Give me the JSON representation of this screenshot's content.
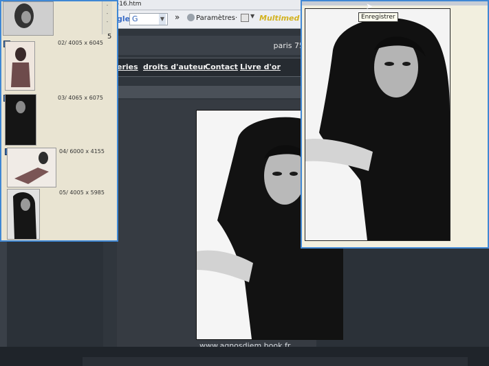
{
  "browser": {
    "url_fragment": "-16.htm",
    "google_logo": "gle",
    "google_combo": "G",
    "more": "»",
    "settings_label": "Paramètres",
    "toolbar_brand": "Multimed"
  },
  "site": {
    "city": "paris 75",
    "nav": [
      "eries",
      "droits d'auteur",
      "Contact",
      "Livre d'or"
    ],
    "footer": "www.agnosdiem.book.fr"
  },
  "thumbs": {
    "page_number": "5",
    "items": [
      {
        "label": "02/  4005 x 6045"
      },
      {
        "label": "03/  4065 x 6075"
      },
      {
        "label": "04/  6000 x 4155"
      },
      {
        "label": "05/  4005 x 5985"
      }
    ]
  },
  "preview": {
    "tooltip": "Enregistrer"
  },
  "colors": {
    "window_border": "#3f87d4",
    "site_bg": "#30363d",
    "panel_bg": "#e9e4d2"
  }
}
